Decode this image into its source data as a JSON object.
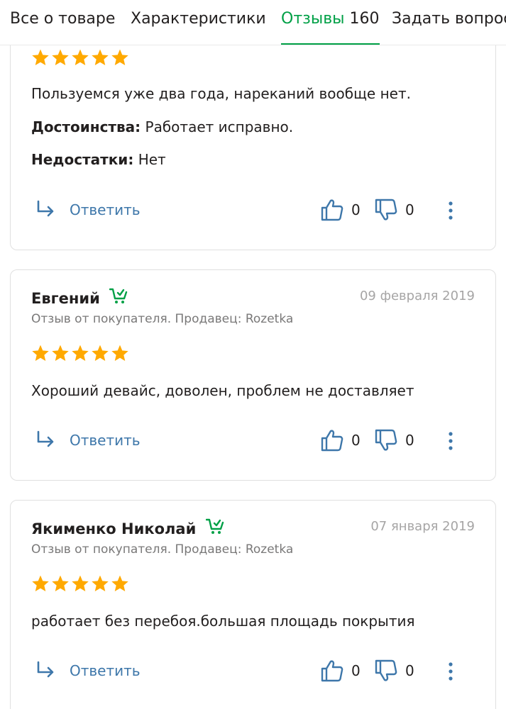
{
  "tabs": [
    {
      "label": "Все о товаре"
    },
    {
      "label": "Характеристики"
    },
    {
      "label": "Отзывы",
      "count": "160",
      "active": true
    },
    {
      "label": "Задать вопрос"
    }
  ],
  "colors": {
    "accent": "#00a046",
    "link": "#3e77aa",
    "star": "#ffa900",
    "muted": "#797878"
  },
  "reviews": [
    {
      "rating": 5,
      "text": "Пользуемся уже два года, нареканий вообще нет.",
      "pros_label": "Достоинства:",
      "pros": "Работает исправно.",
      "cons_label": "Недостатки:",
      "cons": "Нет",
      "reply_label": "Ответить",
      "likes": "0",
      "dislikes": "0"
    },
    {
      "author": "Евгений",
      "date": "09 февраля 2019",
      "meta": "Отзыв от покупателя. Продавец: Rozetka",
      "rating": 5,
      "text": "Хороший девайс, доволен, проблем не доставляет",
      "reply_label": "Ответить",
      "likes": "0",
      "dislikes": "0"
    },
    {
      "author": "Якименко Николай",
      "date": "07 января 2019",
      "meta": "Отзыв от покупателя. Продавец: Rozetka",
      "rating": 5,
      "text": "работает без перебоя.большая площадь покрытия",
      "reply_label": "Ответить",
      "likes": "0",
      "dislikes": "0"
    }
  ],
  "icons": {
    "buyer": "cart-check-icon",
    "star": "star-icon",
    "reply": "reply-arrow-icon",
    "like": "thumbs-up-icon",
    "dislike": "thumbs-down-icon",
    "more": "more-vertical-icon"
  }
}
